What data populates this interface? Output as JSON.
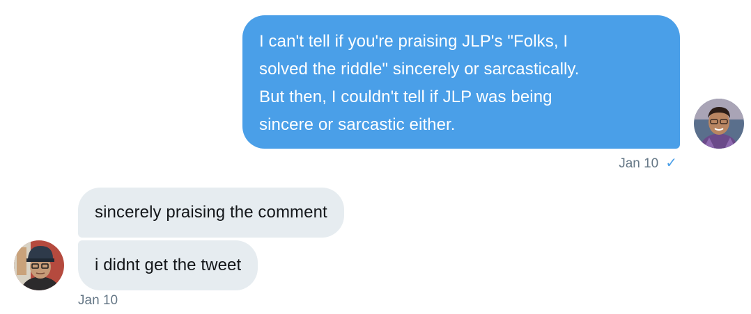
{
  "conversation": {
    "outgoing": {
      "lines": [
        "I can't tell if you're praising JLP's \"Folks, I",
        "solved the riddle\" sincerely or sarcastically.",
        "But then, I couldn't tell if JLP was being",
        "sincere or sarcastic either."
      ],
      "timestamp": "Jan 10",
      "status_icon": "check-icon",
      "status_glyph": "✓",
      "bubble_color": "#4a9fe8"
    },
    "incoming": {
      "messages": [
        "sincerely praising the comment",
        "i didnt get the tweet"
      ],
      "timestamp": "Jan 10",
      "bubble_color": "#e6ecf0"
    }
  }
}
